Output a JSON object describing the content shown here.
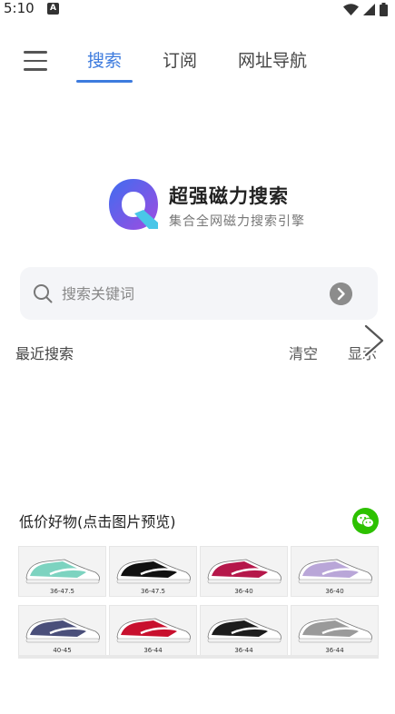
{
  "status": {
    "time": "5:10",
    "badge": "A"
  },
  "nav": {
    "tabs": [
      {
        "label": "搜索"
      },
      {
        "label": "订阅"
      },
      {
        "label": "网址导航"
      }
    ]
  },
  "brand": {
    "title": "超强磁力搜索",
    "subtitle": "集合全网磁力搜索引擎"
  },
  "search": {
    "placeholder": "搜索关键词"
  },
  "recent": {
    "title": "最近搜索",
    "clear": "清空",
    "show": "显示"
  },
  "promo": {
    "title": "低价好物(点击图片预览)",
    "items": [
      {
        "size": "36-47.5",
        "color": "#7dd3c0"
      },
      {
        "size": "36-47.5",
        "color": "#111111"
      },
      {
        "size": "36-40",
        "color": "#b5174a"
      },
      {
        "size": "36-40",
        "color": "#b9a6d8"
      },
      {
        "size": "40-45",
        "color": "#4a4f7a"
      },
      {
        "size": "36-44",
        "color": "#c8102e"
      },
      {
        "size": "36-44",
        "color": "#1c1c1c"
      },
      {
        "size": "36-44",
        "color": "#9a9a9a"
      }
    ]
  },
  "colors": {
    "accent": "#3d7bde",
    "wechat": "#2dc100"
  }
}
